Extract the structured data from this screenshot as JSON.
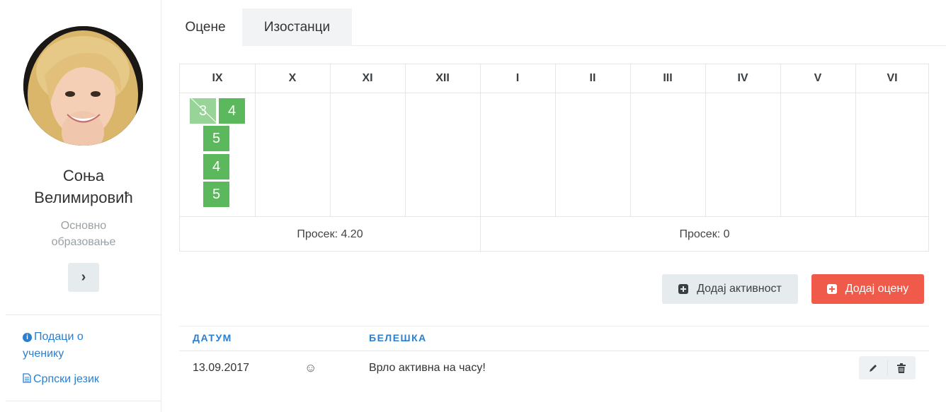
{
  "student": {
    "name_line1": "Соња",
    "name_line2": "Велимировић",
    "program_line1": "Основно",
    "program_line2": "образовање",
    "next_icon": "chevron-right-icon"
  },
  "sidebar": {
    "links": [
      {
        "icon": "info-circle-icon",
        "label_line1": "Подаци о",
        "label_line2": "ученику"
      },
      {
        "icon": "document-icon",
        "label": "Српски језик"
      }
    ]
  },
  "tabs": [
    {
      "label": "Оцене",
      "active": true
    },
    {
      "label": "Изостанци",
      "active": false
    }
  ],
  "grades_table": {
    "months": [
      "IX",
      "X",
      "XI",
      "XII",
      "I",
      "II",
      "III",
      "IV",
      "V",
      "VI"
    ],
    "september_grades": [
      {
        "value": "3",
        "crossed": true
      },
      {
        "value": "4",
        "crossed": false
      },
      {
        "value": "5",
        "crossed": false
      },
      {
        "value": "4",
        "crossed": false
      },
      {
        "value": "5",
        "crossed": false
      }
    ],
    "averages": [
      "Просек: 4.20",
      "Просек: 0"
    ],
    "grade_color": "#5cb85c"
  },
  "actions": {
    "add_activity": "Додај активност",
    "add_grade": "Додај оцену",
    "add_grade_color": "#f05a4a"
  },
  "notes": {
    "headers": {
      "date": "ДАТУМ",
      "note": "БЕЛЕШКА"
    },
    "rows": [
      {
        "date": "13.09.2017",
        "mood_icon": "smiley-icon",
        "mood": "☺",
        "note": "Врло активна на часу!"
      }
    ]
  }
}
